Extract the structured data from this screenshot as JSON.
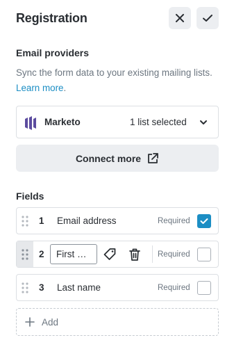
{
  "header": {
    "title": "Registration",
    "close_icon": "close-icon",
    "confirm_icon": "checkmark-icon"
  },
  "email_providers": {
    "title": "Email providers",
    "description": "Sync the form data to your existing mailing lists.",
    "learn_more": "Learn more",
    "provider": {
      "name": "Marketo",
      "selection": "1 list selected",
      "logo_icon": "marketo-logo-icon",
      "brand_color": "#5c4c9f"
    },
    "connect_more": "Connect more"
  },
  "fields": {
    "title": "Fields",
    "items": [
      {
        "number": "1",
        "label": "Email address",
        "required_label": "Required",
        "required": true
      },
      {
        "number": "2",
        "label": "First name",
        "required_label": "Required",
        "required": false,
        "editing": true
      },
      {
        "number": "3",
        "label": "Last name",
        "required_label": "Required",
        "required": false
      }
    ],
    "add_label": "Add"
  },
  "colors": {
    "accent": "#1c8ec4",
    "button_bg": "#eceef1",
    "border": "#dcdfe3"
  }
}
